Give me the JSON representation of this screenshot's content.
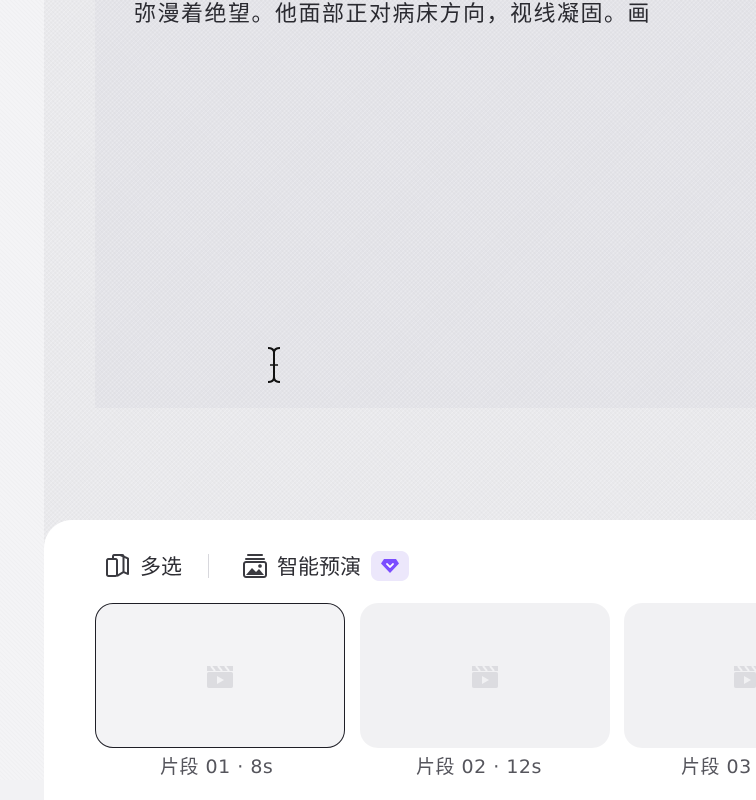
{
  "script": {
    "text_line": "弥漫着绝望。他面部正对病床方向，视线凝固。画"
  },
  "toolbar": {
    "multi_select_label": "多选",
    "smart_preview_label": "智能预演"
  },
  "clips": [
    {
      "label": "片段 01 · 8s",
      "selected": true
    },
    {
      "label": "片段 02 · 12s",
      "selected": false
    },
    {
      "label": "片段 03",
      "selected": false
    }
  ],
  "colors": {
    "accent_purple": "#7b4dff",
    "badge_bg": "#ece7fb",
    "selected_border": "#1e1e26"
  },
  "icons": {
    "multi_select": "stacked-cards-icon",
    "smart_preview": "image-stack-icon",
    "vip": "diamond-icon",
    "clip_placeholder": "video-clapper-icon",
    "cursor": "text-cursor-icon"
  }
}
